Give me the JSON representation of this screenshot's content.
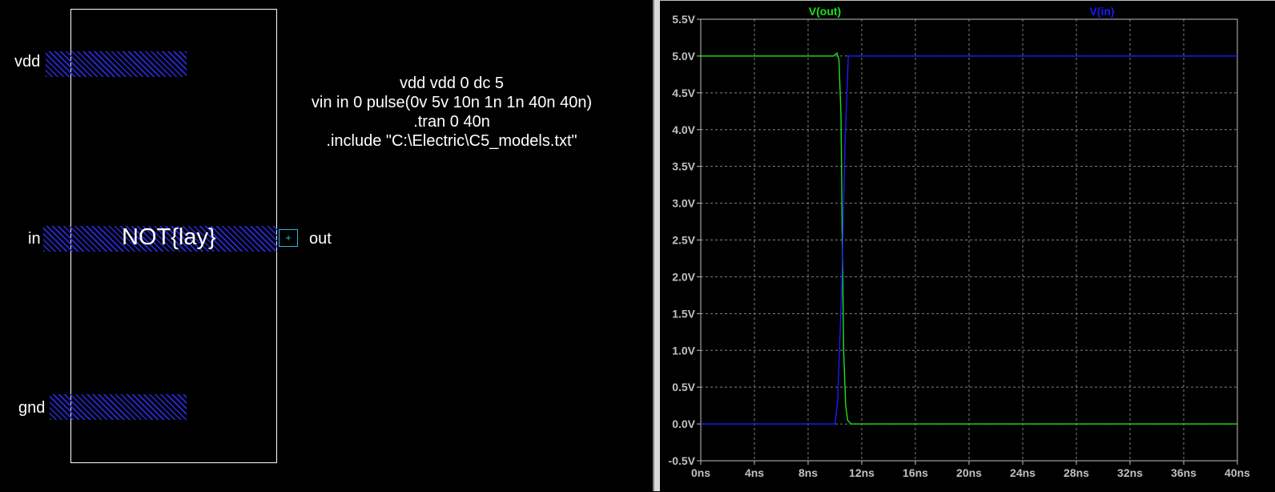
{
  "schematic": {
    "cell_name": "NOT{lay}",
    "ports": {
      "vdd": "vdd",
      "in": "in",
      "gnd": "gnd",
      "out": "out"
    },
    "out_port_symbol": "+",
    "spice_lines": [
      "vdd vdd 0 dc 5",
      "vin in 0 pulse(0v 5v 10n 1n 1n 40n 40n)",
      ".tran 0 40n",
      ".include \"C:\\Electric\\C5_models.txt\""
    ]
  },
  "colors": {
    "background": "#000000",
    "hatch_metal": "#2a2ae0",
    "port_box": "#26b8e0",
    "grid": "#808080",
    "axis": "#c0c0c0",
    "vout_trace": "#1ee01e",
    "vin_trace": "#1a1aff"
  },
  "chart_data": {
    "type": "line",
    "title": "",
    "xlabel": "",
    "ylabel": "",
    "xlim": [
      0,
      40
    ],
    "ylim": [
      -0.5,
      5.5
    ],
    "x_unit": "ns",
    "y_unit": "V",
    "x_ticks": [
      "0ns",
      "4ns",
      "8ns",
      "12ns",
      "16ns",
      "20ns",
      "24ns",
      "28ns",
      "32ns",
      "36ns",
      "40ns"
    ],
    "y_ticks": [
      "5.5V",
      "5.0V",
      "4.5V",
      "4.0V",
      "3.5V",
      "3.0V",
      "2.5V",
      "2.0V",
      "1.5V",
      "1.0V",
      "0.5V",
      "0.0V",
      "-0.5V"
    ],
    "grid": true,
    "legend_placement": "top",
    "series": [
      {
        "name": "V(out)",
        "color": "#1ee01e",
        "x": [
          0,
          9.9,
          10.15,
          10.3,
          10.45,
          10.55,
          10.65,
          10.8,
          10.95,
          11.2,
          11.5,
          40
        ],
        "y": [
          5.0,
          5.0,
          5.04,
          4.95,
          4.2,
          2.5,
          1.0,
          0.25,
          0.05,
          0.0,
          0.0,
          0.0
        ]
      },
      {
        "name": "V(in)",
        "color": "#1a1aff",
        "x": [
          0,
          10.0,
          10.2,
          10.5,
          10.75,
          11.0,
          40
        ],
        "y": [
          0.0,
          0.0,
          0.3,
          1.8,
          3.8,
          5.0,
          5.0
        ]
      }
    ]
  }
}
